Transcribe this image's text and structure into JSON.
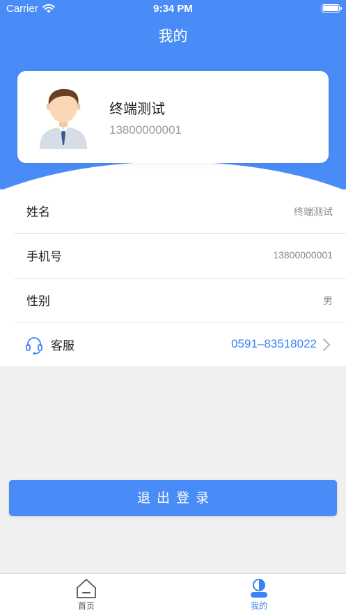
{
  "status_bar": {
    "carrier": "Carrier",
    "time": "9:34 PM"
  },
  "header": {
    "title": "我的",
    "accent_color": "#4a8cf7"
  },
  "profile": {
    "name": "终端测试",
    "phone": "13800000001",
    "avatar_icon": "user-avatar-icon"
  },
  "info": {
    "rows": [
      {
        "label": "姓名",
        "value": "终端测试"
      },
      {
        "label": "手机号",
        "value": "13800000001"
      },
      {
        "label": "性别",
        "value": "男"
      }
    ],
    "service": {
      "label": "客服",
      "value": "0591–83518022",
      "icon": "headset-icon",
      "link_color": "#3b82f6"
    }
  },
  "logout": {
    "label": "退出登录"
  },
  "tab_bar": {
    "tabs": [
      {
        "label": "首页",
        "icon": "home-icon",
        "active": false
      },
      {
        "label": "我的",
        "icon": "profile-icon",
        "active": true
      }
    ]
  }
}
